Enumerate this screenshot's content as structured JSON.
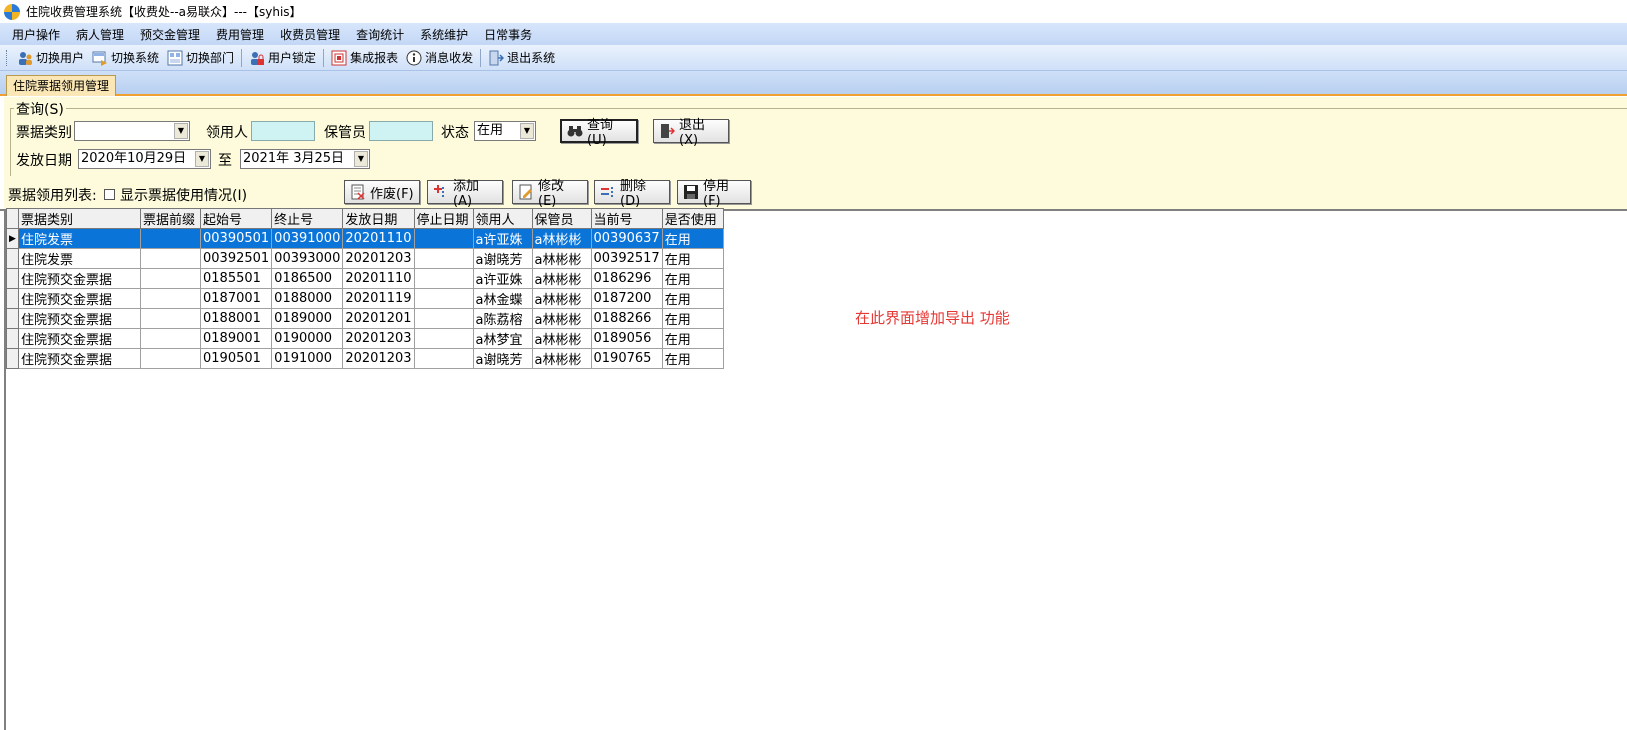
{
  "window": {
    "title": "住院收费管理系统【收费处--a易联众】---【syhis】"
  },
  "menu": [
    "用户操作",
    "病人管理",
    "预交金管理",
    "费用管理",
    "收费员管理",
    "查询统计",
    "系统维护",
    "日常事务"
  ],
  "toolbar": [
    {
      "label": "切换用户",
      "icon": "switch-user-icon"
    },
    {
      "label": "切换系统",
      "icon": "switch-system-icon"
    },
    {
      "label": "切换部门",
      "icon": "switch-department-icon"
    },
    {
      "label": "用户锁定",
      "icon": "lock-user-icon"
    },
    {
      "label": "集成报表",
      "icon": "report-icon"
    },
    {
      "label": "消息收发",
      "icon": "info-icon"
    },
    {
      "label": "退出系统",
      "icon": "exit-icon"
    }
  ],
  "tab": {
    "label": "住院票据领用管理"
  },
  "query": {
    "legend": "查询(S)",
    "bill_type_label": "票据类别",
    "bill_type_value": "",
    "recipient_label": "领用人",
    "recipient_value": "",
    "custodian_label": "保管员",
    "custodian_value": "",
    "status_label": "状态",
    "status_value": "在用",
    "search_button": "查询(U)",
    "exit_button": "退出(X)",
    "date_label": "发放日期",
    "date_from": "2020年10月29日",
    "date_to_label": "至",
    "date_to": "2021年  3月25日"
  },
  "list": {
    "label": "票据领用列表:",
    "show_usage_checkbox": "显示票据使用情况(I)",
    "buttons": {
      "void": "作废(F)",
      "add": "添加(A)",
      "edit": "修改(E)",
      "delete": "删除(D)",
      "disable": "停用(F)"
    }
  },
  "table": {
    "columns": [
      "票据类别",
      "票据前缀",
      "起始号",
      "终止号",
      "发放日期",
      "停止日期",
      "领用人",
      "保管员",
      "当前号",
      "是否使用"
    ],
    "rows": [
      [
        "住院发票",
        "",
        "00390501",
        "00391000",
        "20201110",
        "",
        "a许亚姝",
        "a林彬彬",
        "00390637",
        "在用"
      ],
      [
        "住院发票",
        "",
        "00392501",
        "00393000",
        "20201203",
        "",
        "a谢晓芳",
        "a林彬彬",
        "00392517",
        "在用"
      ],
      [
        "住院预交金票据",
        "",
        "0185501",
        "0186500",
        "20201110",
        "",
        "a许亚姝",
        "a林彬彬",
        "0186296",
        "在用"
      ],
      [
        "住院预交金票据",
        "",
        "0187001",
        "0188000",
        "20201119",
        "",
        "a林金蝶",
        "a林彬彬",
        "0187200",
        "在用"
      ],
      [
        "住院预交金票据",
        "",
        "0188001",
        "0189000",
        "20201201",
        "",
        "a陈荔榕",
        "a林彬彬",
        "0188266",
        "在用"
      ],
      [
        "住院预交金票据",
        "",
        "0189001",
        "0190000",
        "20201203",
        "",
        "a林梦宜",
        "a林彬彬",
        "0189056",
        "在用"
      ],
      [
        "住院预交金票据",
        "",
        "0190501",
        "0191000",
        "20201203",
        "",
        "a谢晓芳",
        "a林彬彬",
        "0190765",
        "在用"
      ]
    ],
    "selected_row": 0
  },
  "note": "在此界面增加导出 功能",
  "colors": {
    "selection": "#0a74d8",
    "note": "#e53935",
    "panel": "#fdfbdb",
    "input": "#cff3f3"
  }
}
